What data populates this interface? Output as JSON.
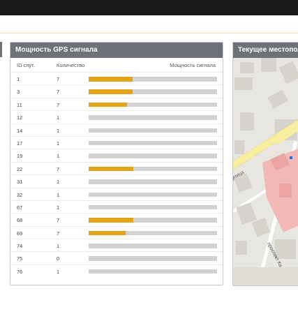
{
  "gps_panel": {
    "title": "Мощность GPS сигнала",
    "columns": {
      "id": "ID спут.",
      "count": "Количество",
      "strength": "Мощность сигнала"
    },
    "rows": [
      {
        "id": "1",
        "count": "7",
        "strength": 0.34
      },
      {
        "id": "3",
        "count": "7",
        "strength": 0.34
      },
      {
        "id": "11",
        "count": "7",
        "strength": 0.3
      },
      {
        "id": "12",
        "count": "1",
        "strength": 0
      },
      {
        "id": "14",
        "count": "1",
        "strength": 0
      },
      {
        "id": "17",
        "count": "1",
        "strength": 0
      },
      {
        "id": "19",
        "count": "1",
        "strength": 0
      },
      {
        "id": "22",
        "count": "7",
        "strength": 0.35
      },
      {
        "id": "31",
        "count": "1",
        "strength": 0
      },
      {
        "id": "32",
        "count": "1",
        "strength": 0
      },
      {
        "id": "67",
        "count": "1",
        "strength": 0
      },
      {
        "id": "68",
        "count": "7",
        "strength": 0.35
      },
      {
        "id": "69",
        "count": "7",
        "strength": 0.29
      },
      {
        "id": "74",
        "count": "1",
        "strength": 0
      },
      {
        "id": "75",
        "count": "0",
        "strength": 0
      },
      {
        "id": "76",
        "count": "1",
        "strength": 0
      }
    ],
    "colors": {
      "fill": "#e2a51a",
      "track": "#d2d2d2",
      "header": "#6d7278"
    }
  },
  "map_panel": {
    "title": "Текущее местоположение",
    "street_labels": [
      "улица",
      "проспект Ка"
    ]
  }
}
